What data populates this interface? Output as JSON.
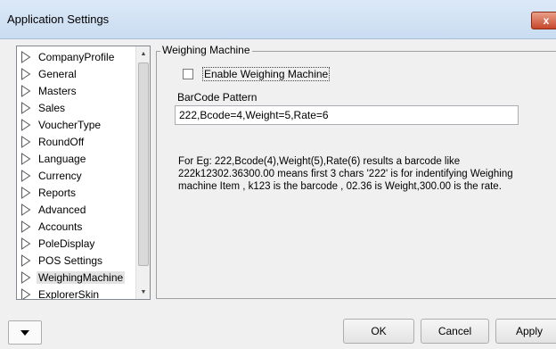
{
  "window": {
    "title": "Application Settings",
    "close_label": "x"
  },
  "tree": {
    "items": [
      {
        "label": "CompanyProfile"
      },
      {
        "label": "General"
      },
      {
        "label": "Masters"
      },
      {
        "label": "Sales"
      },
      {
        "label": "VoucherType"
      },
      {
        "label": "RoundOff"
      },
      {
        "label": "Language"
      },
      {
        "label": "Currency"
      },
      {
        "label": "Reports"
      },
      {
        "label": "Advanced"
      },
      {
        "label": "Accounts"
      },
      {
        "label": "PoleDisplay"
      },
      {
        "label": "POS Settings"
      },
      {
        "label": "WeighingMachine",
        "selected": true
      },
      {
        "label": "ExplorerSkin"
      }
    ],
    "scroll_mid_glyph": "≡"
  },
  "panel": {
    "group_title": "Weighing Machine",
    "enable_label": "Enable Weighing Machine",
    "enable_checked": false,
    "barcode_label": "BarCode Pattern",
    "barcode_value": "222,Bcode=4,Weight=5,Rate=6",
    "note_lines": [
      "For Eg: 222,Bcode(4),Weight(5),Rate(6) results a barcode like",
      "222k12302.36300.00 means first 3 chars '222' is for indentifying Weighing",
      "machine Item , k123 is the barcode , 02.36 is Weight,300.00 is the rate."
    ]
  },
  "buttons": {
    "ok": "OK",
    "cancel": "Cancel",
    "apply": "Apply"
  }
}
